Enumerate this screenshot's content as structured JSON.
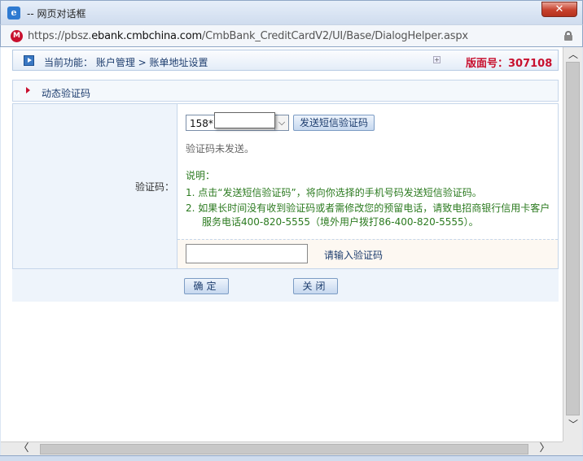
{
  "window": {
    "title": "-- 网页对话框",
    "close_symbol": "✕",
    "app_icon_glyph": "e"
  },
  "address": {
    "prefix": "https://pbsz.",
    "host": "ebank.cmbchina.com",
    "path": "/CmbBank_CreditCardV2/UI/Base/DialogHelper.aspx",
    "site_icon_glyph": "M"
  },
  "header": {
    "breadcrumb": "当前功能： 账户管理 > 账单地址设置",
    "expand_symbol": "+",
    "version": "版面号：307108"
  },
  "section": {
    "title": "动态验证码"
  },
  "form": {
    "field_label": "验证码：",
    "phone_value": "158*",
    "dropdown_arrow": "⌵",
    "send_button": "发送短信验证码",
    "status": "验证码未发送。",
    "note_title": "说明：",
    "note_1": "1. 点击“发送短信验证码”，将向你选择的手机号码发送短信验证码。",
    "note_2": "2. 如果长时间没有收到验证码或者需修改您的预留电话，请致电招商银行信用卡客户",
    "note_3": "服务电话400-820-5555（境外用户拨打86-400-820-5555）。",
    "code_value": "",
    "code_hint": "请输入验证码"
  },
  "actions": {
    "ok": "确定",
    "close": "关闭"
  },
  "scroll": {
    "up": "︿",
    "down": "﹀",
    "left": "〈",
    "right": "〉"
  },
  "colors": {
    "accent": "#c8102e",
    "link": "#1d3d6e",
    "note_green": "#2b7a1f"
  }
}
